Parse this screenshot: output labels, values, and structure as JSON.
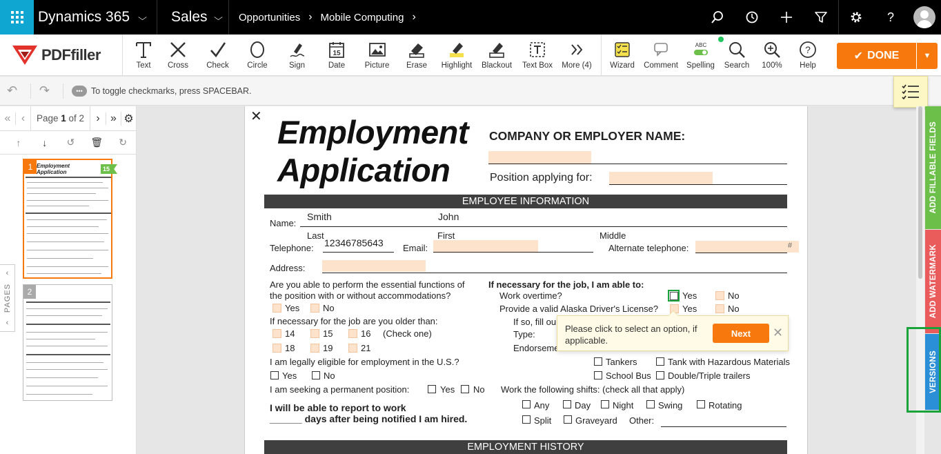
{
  "d365": {
    "app_name": "Dynamics 365",
    "area": "Sales",
    "breadcrumb": [
      "Opportunities",
      "Mobile Computing"
    ]
  },
  "toolbar": {
    "logo": "PDFfiller",
    "tools": [
      "Text",
      "Cross",
      "Check",
      "Circle",
      "Sign",
      "Date",
      "Picture",
      "Erase",
      "Highlight",
      "Blackout",
      "Text Box",
      "More (4)"
    ],
    "tools_right": [
      "Wizard",
      "Comment",
      "Spelling",
      "Search",
      "100%",
      "Help"
    ],
    "spelling_badge": "ABC",
    "date_icon_num": "15",
    "done_label": "DONE"
  },
  "hint": "To toggle checkmarks, press SPACEBAR.",
  "pager": {
    "prefix": "Page",
    "current": "1",
    "of": "of 2"
  },
  "thumbs": {
    "page1_num": "1",
    "page2_num": "2",
    "badge": "15",
    "page1_title": "Employment Application"
  },
  "pages_tab": "PAGES",
  "side_tabs": {
    "fillable": "ADD FILLABLE FIELDS",
    "watermark": "ADD WATERMARK",
    "versions": "VERSIONS"
  },
  "doc": {
    "title1": "Employment",
    "title2": "Application",
    "company_label": "COMPANY OR EMPLOYER NAME:",
    "position_label": "Position applying for:",
    "section1": "EMPLOYEE INFORMATION",
    "name_label": "Name:",
    "last_value": "Smith",
    "first_value": "John",
    "last": "Last",
    "first": "First",
    "middle": "Middle",
    "telephone_label": "Telephone:",
    "telephone_value": "12346785643",
    "email_label": "Email:",
    "alt_tel_label": "Alternate telephone:",
    "hash": "#",
    "address_label": "Address:",
    "q_functions_1": "Are you able to perform the essential functions of",
    "q_functions_2": "the position with or without accommodations?",
    "yes": "Yes",
    "no": "No",
    "q_older": "If necessary for the job are you older than:",
    "ages": [
      "14",
      "15",
      "16",
      "18",
      "19",
      "21"
    ],
    "check_one": "(Check one)",
    "q_eligible": "I am legally eligible for employment in the U.S.?",
    "q_permanent": "I am seeking a permanent position:",
    "q_report_1": "I will be able to report to work",
    "q_report_2": "______ days after being notified I am hired.",
    "if_necessary": "If necessary for the job, I am able to:",
    "overtime": "Work overtime?",
    "license": "Provide a valid Alaska Driver's License?",
    "if_so": "If so, fill ou",
    "type_label": "Type:",
    "endorse_label": "Endorseme",
    "tankers": "Tankers",
    "tank_haz": "Tank with Hazardous Materials",
    "school_bus": "School Bus",
    "double_triple": "Double/Triple trailers",
    "shifts_label": "Work the following shifts: (check all that apply)",
    "shifts": [
      "Any",
      "Day",
      "Night",
      "Swing",
      "Rotating",
      "Split",
      "Graveyard"
    ],
    "other_label": "Other:",
    "section2": "EMPLOYMENT HISTORY"
  },
  "tooltip": {
    "message": "Please click to select an option, if applicable.",
    "next": "Next"
  },
  "colors": {
    "accent": "#f7790e",
    "waffle": "#0fa6d2",
    "field": "#fde3cc",
    "fillable": "#6cc04a",
    "watermark": "#ea5b5b",
    "versions": "#2a8fd6"
  }
}
